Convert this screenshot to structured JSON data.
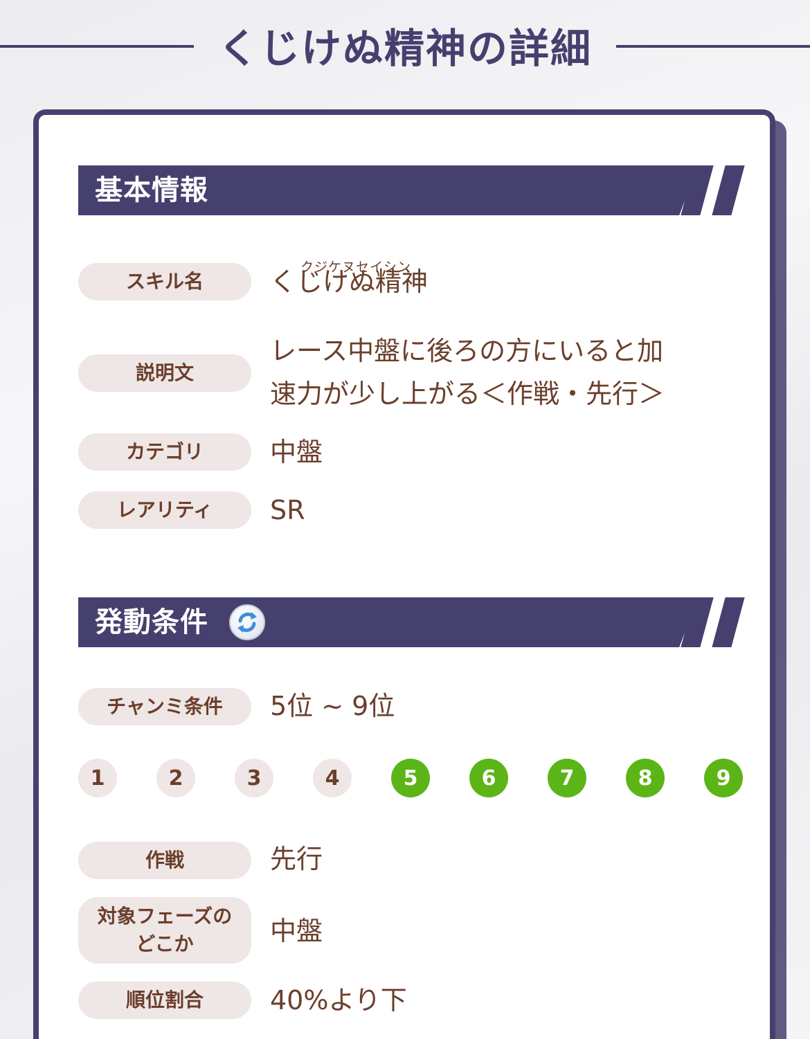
{
  "page": {
    "title": "くじけぬ精神の詳細"
  },
  "basic": {
    "heading": "基本情報",
    "skill_name_label": "スキル名",
    "skill_name_ruby": "クジケヌセイシン",
    "skill_name": "くじけぬ精神",
    "description_label": "説明文",
    "description_line1": "レース中盤に後ろの方にいると加",
    "description_line2": "速力が少し上がる＜作戦・先行＞",
    "category_label": "カテゴリ",
    "category": "中盤",
    "rarity_label": "レアリティ",
    "rarity": "SR"
  },
  "conditions": {
    "heading": "発動条件",
    "heading_icon": "refresh-icon",
    "champ_label": "チャンミ条件",
    "champ_value": "5位 ~ 9位",
    "ranks": [
      {
        "label": "1",
        "active": false
      },
      {
        "label": "2",
        "active": false
      },
      {
        "label": "3",
        "active": false
      },
      {
        "label": "4",
        "active": false
      },
      {
        "label": "5",
        "active": true
      },
      {
        "label": "6",
        "active": true
      },
      {
        "label": "7",
        "active": true
      },
      {
        "label": "8",
        "active": true
      },
      {
        "label": "9",
        "active": true
      }
    ],
    "strategy_label": "作戦",
    "strategy": "先行",
    "phase_label_line1": "対象フェーズの",
    "phase_label_line2": "どこか",
    "phase": "中盤",
    "rank_ratio_label": "順位割合",
    "rank_ratio": "40%より下"
  },
  "colors": {
    "accent": "#45406e",
    "label_bg": "#efe6e6",
    "text_brown": "#6b3f2b",
    "rank_active": "#5cb517",
    "refresh_blue": "#3a8fd9"
  }
}
